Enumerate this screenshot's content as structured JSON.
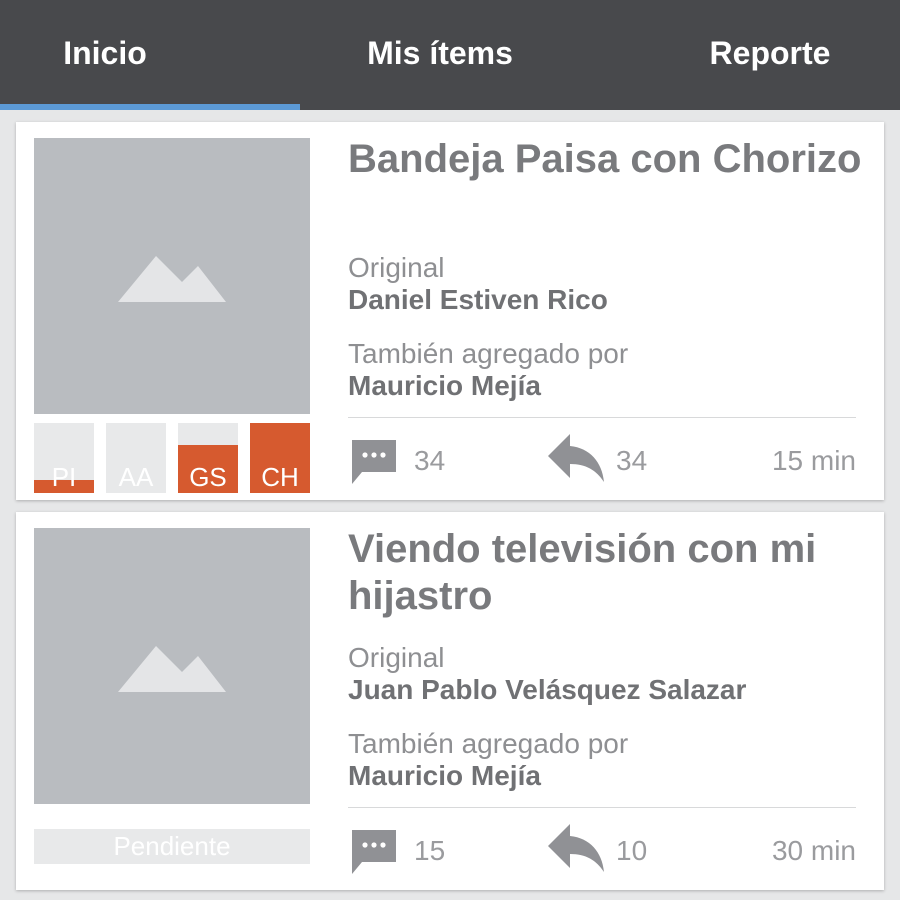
{
  "tabs": [
    {
      "label": "Inicio",
      "active": true
    },
    {
      "label": "Mis ítems",
      "active": false
    },
    {
      "label": "Reporte",
      "active": false
    }
  ],
  "colors": {
    "tabbar": "#48494c",
    "active_indicator": "#5c9ad6",
    "accent": "#d65a2f",
    "placeholder": "#b9bcc0"
  },
  "cards": [
    {
      "title": "Bandeja Paisa con Chorizo",
      "original_label": "Original",
      "original_name": "Daniel Estiven Rico",
      "also_label": "También agregado por",
      "also_name": "Mauricio Mejía",
      "comments": "34",
      "shares": "34",
      "time": "15 min",
      "indicators": [
        {
          "label": "PI",
          "level": 0.18
        },
        {
          "label": "AA",
          "level": 0.0
        },
        {
          "label": "GS",
          "level": 0.68
        },
        {
          "label": "CH",
          "level": 1.0
        }
      ]
    },
    {
      "title": "Viendo televisión con mi hijastro",
      "original_label": "Original",
      "original_name": "Juan Pablo Velásquez Salazar",
      "also_label": "También agregado por",
      "also_name": "Mauricio Mejía",
      "comments": "15",
      "shares": "10",
      "time": "30 min",
      "status": "Pendiente"
    }
  ],
  "icons": {
    "image_placeholder": "image-placeholder-icon",
    "comment": "comment-icon",
    "reply": "reply-icon"
  }
}
